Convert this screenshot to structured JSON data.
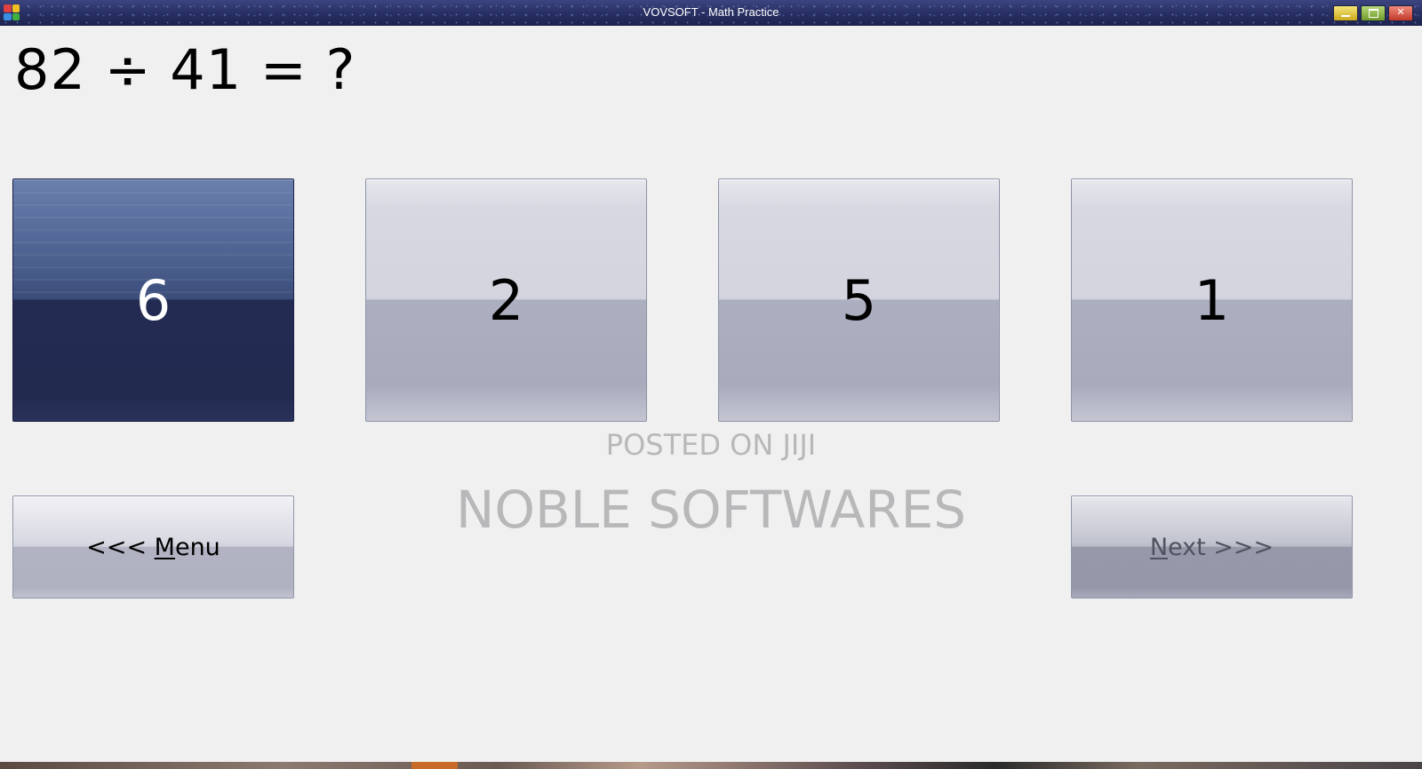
{
  "window": {
    "title": "VOVSOFT - Math Practice"
  },
  "question": {
    "text": "82 ÷ 41 = ?"
  },
  "answers": [
    {
      "label": "6",
      "selected": true
    },
    {
      "label": "2",
      "selected": false
    },
    {
      "label": "5",
      "selected": false
    },
    {
      "label": "1",
      "selected": false
    }
  ],
  "navigation": {
    "menu_prefix": "<<< ",
    "menu_hotkey": "M",
    "menu_rest": "enu",
    "next_hotkey": "N",
    "next_rest": "ext >>>"
  },
  "watermark": {
    "line1": "POSTED ON JIJI",
    "line2": "NOBLE SOFTWARES"
  },
  "colors": {
    "selected_answer": "#232b52",
    "titlebar": "#2a3266",
    "background": "#f0f0f0"
  },
  "icons": {
    "app": "app-icon",
    "minimize": "minimize-icon",
    "maximize": "maximize-icon",
    "close": "close-icon"
  }
}
